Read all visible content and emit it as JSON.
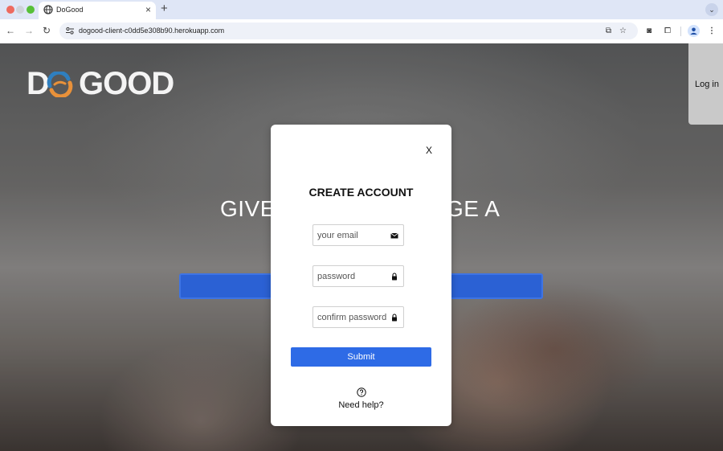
{
  "browser": {
    "tab_title": "DoGood",
    "tab_close": "×",
    "new_tab": "+",
    "url": "dogood-client-c0dd5e308b90.herokuapp.com"
  },
  "header": {
    "logo_d": "D",
    "logo_rest": "GOOD",
    "login_label": "Log in"
  },
  "hero": {
    "headline_left": "GIVE",
    "headline_right": "GE A"
  },
  "modal": {
    "close_label": "X",
    "title": "CREATE ACCOUNT",
    "email_placeholder": "your email",
    "password_placeholder": "password",
    "confirm_placeholder": "confirm password",
    "submit_label": "Submit",
    "help_text": "Need help?"
  },
  "colors": {
    "accent": "#2e6be6",
    "logo_orange": "#e8913a",
    "logo_blue": "#2f7fbf"
  },
  "icons": {
    "email": "envelope-icon",
    "password": "lock-icon",
    "confirm": "lock-icon",
    "help": "question-circle-icon"
  }
}
